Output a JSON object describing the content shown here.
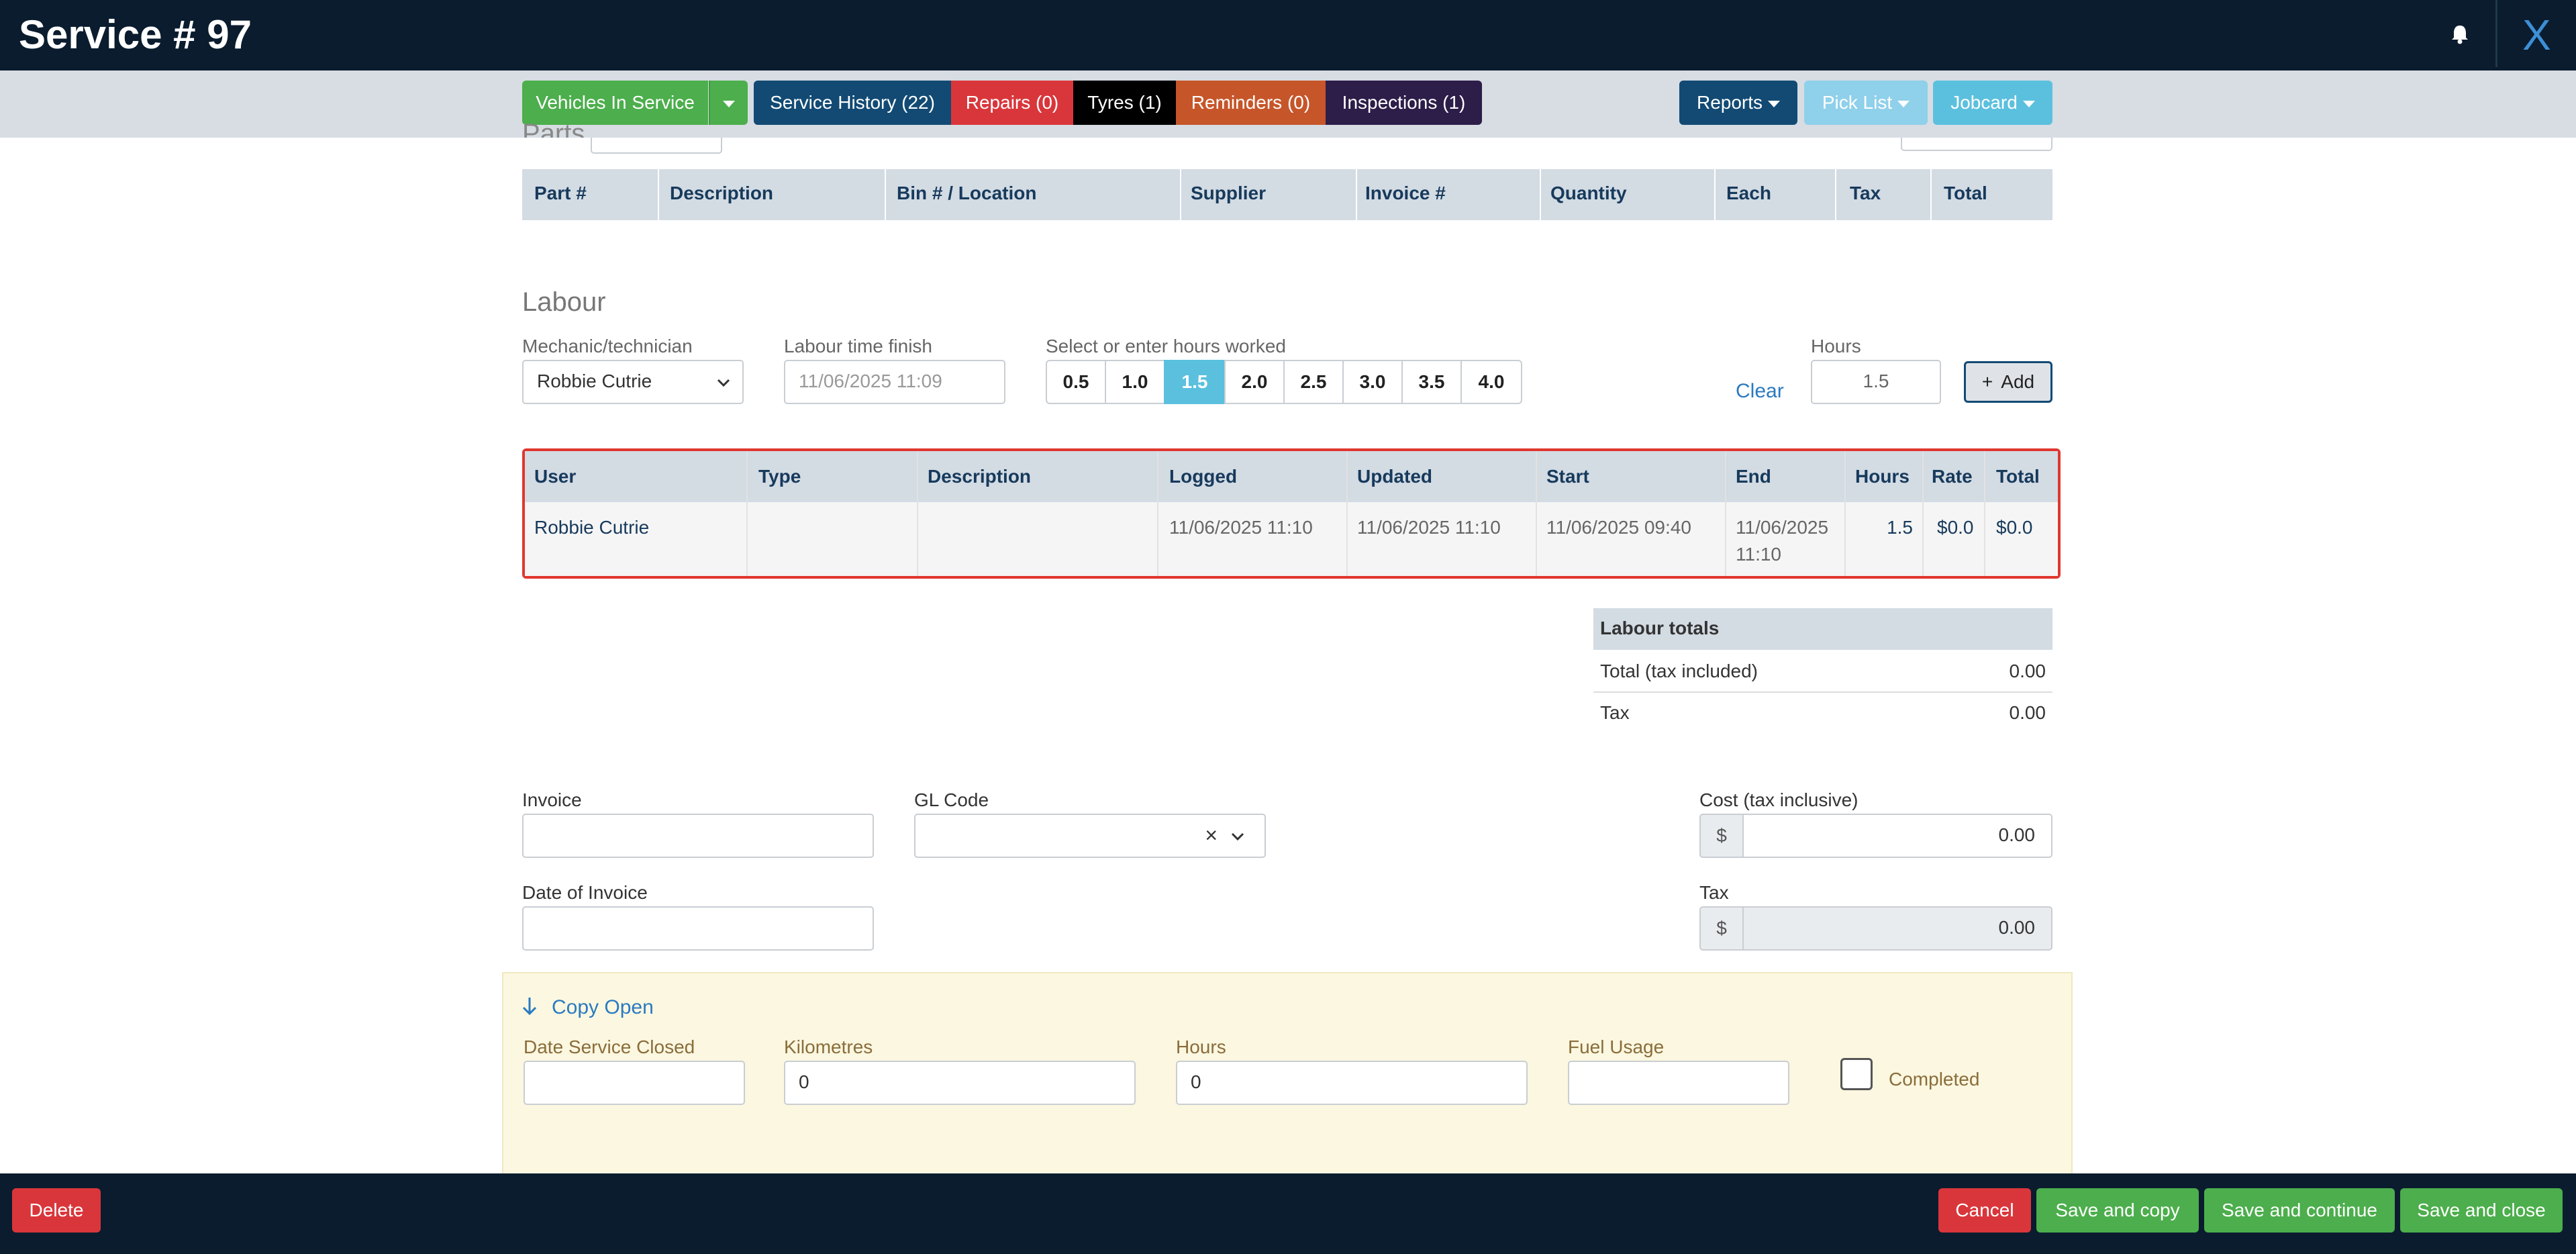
{
  "header": {
    "title": "Service # 97",
    "close_label": "X"
  },
  "nav": {
    "vehicles_in_service": "Vehicles In Service",
    "service_history": "Service History (22)",
    "repairs": "Repairs (0)",
    "tyres": "Tyres (1)",
    "reminders": "Reminders (0)",
    "inspections": "Inspections (1)",
    "reports": "Reports",
    "pick_list": "Pick List",
    "jobcard": "Jobcard"
  },
  "parts": {
    "section_title": "Parts",
    "columns": [
      "Part #",
      "Description",
      "Bin # / Location",
      "Supplier",
      "Invoice #",
      "Quantity",
      "Each",
      "Tax",
      "Total"
    ]
  },
  "labour": {
    "section_title": "Labour",
    "mechanic_label": "Mechanic/technician",
    "mechanic_value": "Robbie Cutrie",
    "finish_label": "Labour time finish",
    "finish_placeholder": "11/06/2025 11:09",
    "hours_select_label": "Select or enter hours worked",
    "hour_options": [
      "0.5",
      "1.0",
      "1.5",
      "2.0",
      "2.5",
      "3.0",
      "3.5",
      "4.0"
    ],
    "selected_hours": "1.5",
    "clear_label": "Clear",
    "hours_label": "Hours",
    "hours_value": "1.5",
    "add_label": "Add",
    "table": {
      "columns": [
        "User",
        "Type",
        "Description",
        "Logged",
        "Updated",
        "Start",
        "End",
        "Hours",
        "Rate",
        "Total"
      ],
      "rows": [
        {
          "user": "Robbie Cutrie",
          "type": "",
          "description": "",
          "logged": "11/06/2025 11:10",
          "updated": "11/06/2025 11:10",
          "start": "11/06/2025 09:40",
          "end_line1": "11/06/2025",
          "end_line2": "11:10",
          "hours": "1.5",
          "rate": "$0.0",
          "total": "$0.0"
        }
      ]
    },
    "totals": {
      "title": "Labour totals",
      "total_label": "Total (tax included)",
      "total_value": "0.00",
      "tax_label": "Tax",
      "tax_value": "0.00"
    }
  },
  "invoice": {
    "invoice_label": "Invoice",
    "gl_code_label": "GL Code",
    "date_label": "Date of Invoice",
    "cost_label": "Cost (tax inclusive)",
    "cost_prefix": "$",
    "cost_value": "0.00",
    "tax_label": "Tax",
    "tax_prefix": "$",
    "tax_value": "0.00"
  },
  "close_section": {
    "copy_open": "Copy Open",
    "date_closed_label": "Date Service Closed",
    "kilometres_label": "Kilometres",
    "kilometres_value": "0",
    "hours_label": "Hours",
    "hours_value": "0",
    "fuel_label": "Fuel Usage",
    "completed_label": "Completed"
  },
  "footer": {
    "delete": "Delete",
    "cancel": "Cancel",
    "save_copy": "Save and copy",
    "save_continue": "Save and continue",
    "save_close": "Save and close"
  },
  "colors": {
    "header_bg": "#0a1c2e",
    "green": "#4cae4c",
    "navy": "#124a73",
    "red": "#d9363b",
    "orange": "#c6562a",
    "purple": "#2d1d49",
    "light_blue": "#5bc0de",
    "highlight_border": "#e0372f"
  }
}
